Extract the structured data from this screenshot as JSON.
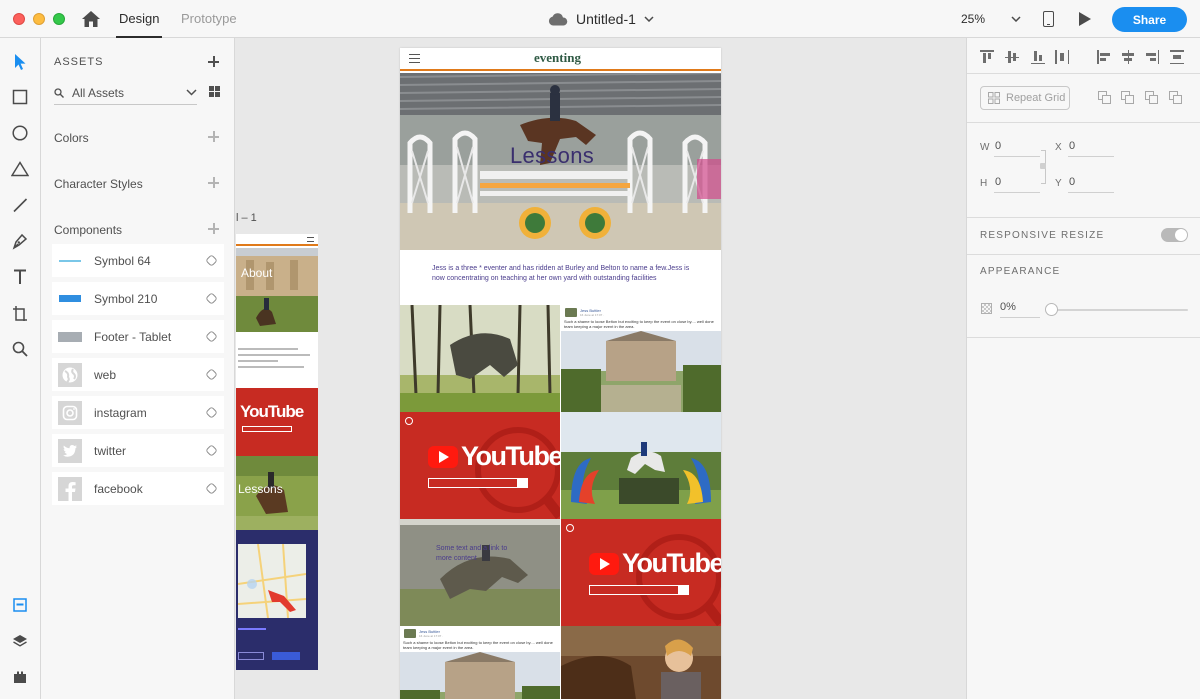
{
  "titlebar": {
    "tabs": [
      {
        "label": "Design",
        "active": true
      },
      {
        "label": "Prototype",
        "active": false
      }
    ],
    "document_title": "Untitled-1",
    "zoom": "25%",
    "share_label": "Share",
    "accent": "#1a8ef0"
  },
  "tools": [
    "select-tool",
    "rectangle-tool",
    "ellipse-tool",
    "polygon-tool",
    "line-tool",
    "pen-tool",
    "text-tool",
    "artboard-tool",
    "zoom-tool",
    "assets-panel",
    "layers-panel",
    "plugins-panel"
  ],
  "assets": {
    "title": "ASSETS",
    "filter_value": "All Assets",
    "colors_label": "Colors",
    "character_styles_label": "Character Styles",
    "components_label": "Components",
    "components": [
      {
        "label": "Symbol 64",
        "icon": "line-thumb"
      },
      {
        "label": "Symbol 210",
        "icon": "blue-bar-thumb"
      },
      {
        "label": "Footer - Tablet",
        "icon": "gray-bar-thumb"
      },
      {
        "label": "web",
        "icon": "globe-icon"
      },
      {
        "label": "instagram",
        "icon": "instagram-icon"
      },
      {
        "label": "twitter",
        "icon": "twitter-icon"
      },
      {
        "label": "facebook",
        "icon": "facebook-icon"
      }
    ]
  },
  "canvas": {
    "side_artboard_label": "l – 1",
    "side_about": "About",
    "side_lessons": "Lessons",
    "side_youtube": "YouTube",
    "main": {
      "logo": "eventing",
      "hero_title": "Lessons",
      "intro_text": "Jess is a three * eventer and has ridden at Burley and Belton to name a few.Jess is now concentrating on teaching at her own yard with outstanding facilities",
      "youtube_word": "YouTube",
      "fb_name": "Jess Buttler",
      "fb_time": "16 June at 17:07 · ",
      "fb_text": "Such a shame to loose Belton but exciting to keep the event on close by.... well done team keeping a major event in the area.",
      "tile_caption": "Some text and a link to more content"
    }
  },
  "properties": {
    "repeat_grid_label": "Repeat Grid",
    "w_label": "W",
    "w_value": "0",
    "h_label": "H",
    "h_value": "0",
    "x_label": "X",
    "x_value": "0",
    "y_label": "Y",
    "y_value": "0",
    "responsive_resize_label": "RESPONSIVE RESIZE",
    "appearance_label": "APPEARANCE",
    "opacity_value": "0%",
    "opacity_level": 0
  }
}
